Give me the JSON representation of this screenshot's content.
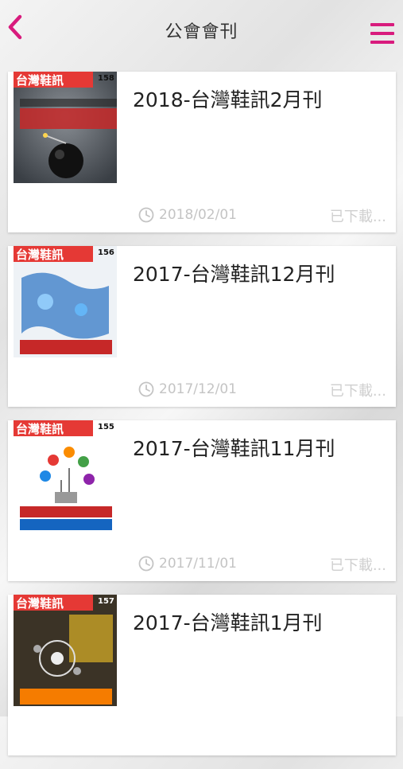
{
  "header": {
    "title": "公會會刊",
    "back_icon": "chevron-left-icon",
    "menu_icon": "hamburger-menu-icon"
  },
  "colors": {
    "accent": "#d81b7d",
    "date_text": "#c4c4c4",
    "status_text": "#cfcfcf"
  },
  "issues": [
    {
      "title": "2018-台灣鞋訊2月刊",
      "date": "2018/02/01",
      "status": "已下載...",
      "cover": {
        "masthead": "台灣鞋訊",
        "number": "158"
      }
    },
    {
      "title": "2017-台灣鞋訊12月刊",
      "date": "2017/12/01",
      "status": "已下載...",
      "cover": {
        "masthead": "台灣鞋訊",
        "number": "156"
      }
    },
    {
      "title": "2017-台灣鞋訊11月刊",
      "date": "2017/11/01",
      "status": "已下載...",
      "cover": {
        "masthead": "台灣鞋訊",
        "number": "155"
      }
    },
    {
      "title": "2017-台灣鞋訊1月刊",
      "date": "",
      "status": "",
      "cover": {
        "masthead": "台灣鞋訊",
        "number": "157"
      }
    }
  ]
}
